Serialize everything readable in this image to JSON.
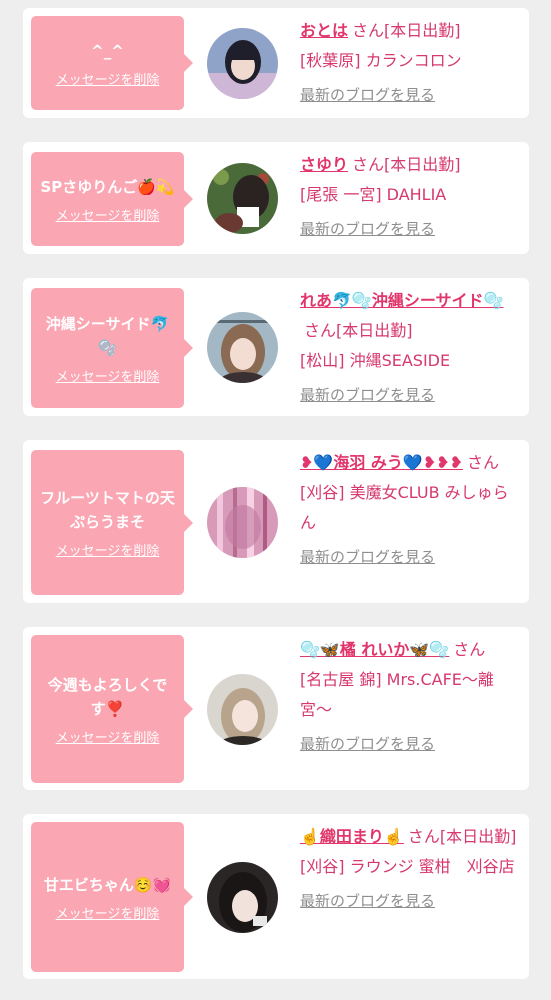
{
  "cards": [
    {
      "message": "^_^",
      "delete_label": "メッセージを削除",
      "name": "おとは",
      "suffix": "さん[本日出勤]",
      "shop": "[秋葉原] カランコロン",
      "blog_label": "最新のブログを見る"
    },
    {
      "message": "SPさゆりんご🍎💫",
      "delete_label": "メッセージを削除",
      "name": "さゆり",
      "suffix": "さん[本日出勤]",
      "shop": "[尾張 一宮] DAHLIA",
      "blog_label": "最新のブログを見る"
    },
    {
      "message": "沖縄シーサイド🐬🫧",
      "delete_label": "メッセージを削除",
      "name": "れあ🐬🫧沖縄シーサイド🫧",
      "suffix": "さん[本日出勤]",
      "shop": "[松山] 沖縄SEASIDE",
      "blog_label": "最新のブログを見る"
    },
    {
      "message": "フルーツトマトの天ぷらうまそ",
      "delete_label": "メッセージを削除",
      "name": "❥💙海羽 みう💙❥❥❥",
      "suffix": "さん",
      "shop": "[刈谷] 美魔女CLUB みしゅらん",
      "blog_label": "最新のブログを見る"
    },
    {
      "message": "今週もよろしくです❣️",
      "delete_label": "メッセージを削除",
      "name": "🫧🦋橘 れいか🦋🫧",
      "suffix": "さん",
      "shop": "[名古屋 錦] Mrs.CAFE〜離宮〜",
      "blog_label": "最新のブログを見る"
    },
    {
      "message": "甘エビちゃん☺️💓",
      "delete_label": "メッセージを削除",
      "name": "☝️織田まり☝️",
      "suffix": "さん[本日出勤]",
      "shop": "[刈谷] ラウンジ 蜜柑　刈谷店",
      "blog_label": "最新のブログを見る"
    }
  ]
}
